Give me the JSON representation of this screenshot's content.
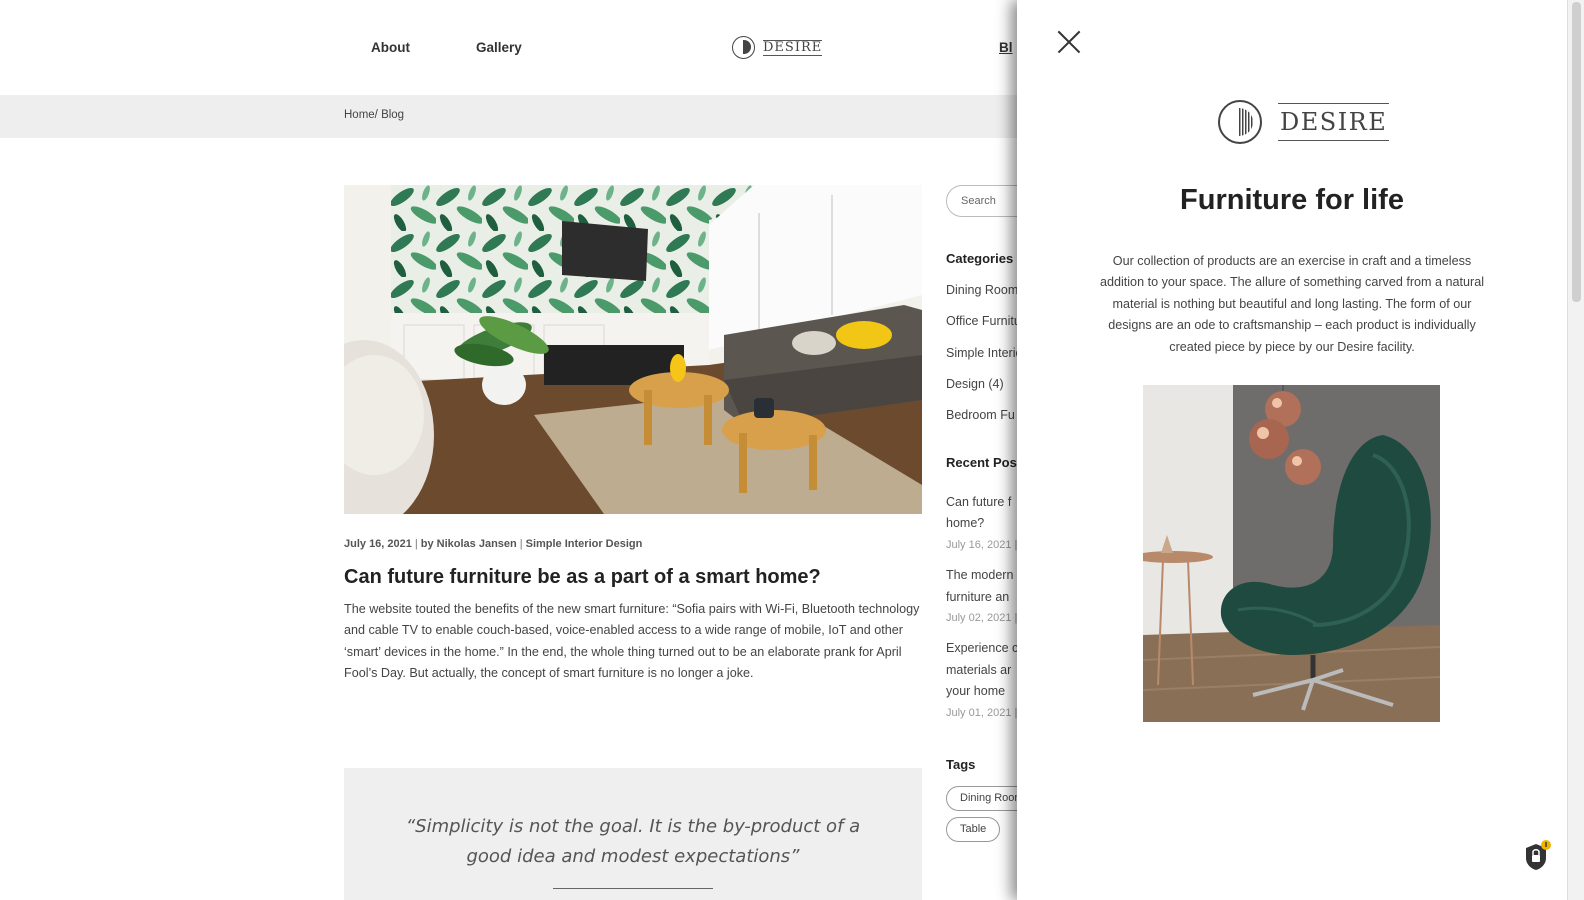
{
  "nav": {
    "about": "About",
    "gallery": "Gallery",
    "blog_partial": "Bl",
    "logo_text": "DESIRE"
  },
  "breadcrumb": "Home/ Blog",
  "post": {
    "date": "July 16, 2021",
    "by_label": "by",
    "author": "Nikolas Jansen",
    "category": "Simple Interior Design",
    "title": "Can future furniture be as a part of a smart home?",
    "excerpt": "The website touted the benefits of the new smart furniture: “Sofia pairs with Wi-Fi, Bluetooth technology and cable TV to enable couch-based, voice-enabled access to a wide range of mobile, IoT and other ‘smart’ devices in the home.” In the end, the whole thing turned out to be an elaborate prank for April Fool’s Day. But actually, the concept of smart furniture is no longer a joke."
  },
  "quote": "“Simplicity is not the goal. It is the by-product of a good idea and modest expectations”",
  "sidebar": {
    "search_placeholder": "Search",
    "categories_title": "Categories",
    "categories": [
      "Dining Room",
      "Office Furniture",
      "Simple Interior",
      "Design (4)",
      "Bedroom Fu"
    ],
    "recent_title": "Recent Pos",
    "recent": [
      {
        "line1": "Can future f",
        "line2": "home?",
        "date": "July 16, 2021 |"
      },
      {
        "line1": "The modern",
        "line2": "furniture an",
        "date": "July 02, 2021 |"
      },
      {
        "line1": "Experience c",
        "line2": "materials ar",
        "line3": "your home",
        "date": "July 01, 2021 |"
      }
    ],
    "tags_title": "Tags",
    "tags": [
      "Dining Room",
      "Table"
    ]
  },
  "panel": {
    "logo_text": "DESIRE",
    "title": "Furniture for life",
    "text": "Our collection of products are an exercise in craft and a timeless addition to your space. The allure of something carved from a natural material is nothing but beautiful and long lasting. The form of our designs are an ode to craftsmanship – each product is individually created piece by piece by our Desire facility."
  },
  "colors": {
    "panel_bg": "#ffffff",
    "crumb_bar": "#eeeeee",
    "quote_bg": "#efefef",
    "text": "#333333",
    "accent_badge": "#f0b400"
  }
}
